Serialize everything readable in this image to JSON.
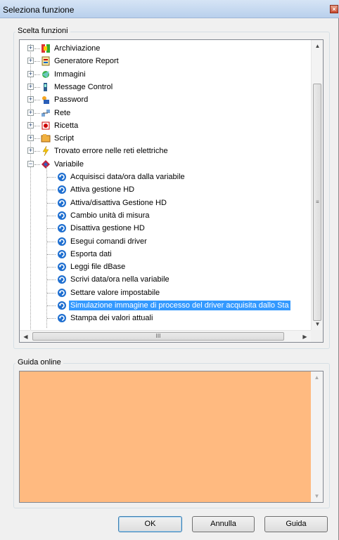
{
  "window": {
    "title": "Seleziona funzione",
    "close_glyph": "×"
  },
  "group_functions": {
    "label": "Scelta funzioni"
  },
  "group_help": {
    "label": "Guida online"
  },
  "tree": {
    "items": [
      {
        "label": "Archiviazione",
        "icon": "archive-icon"
      },
      {
        "label": "Generatore Report",
        "icon": "report-icon"
      },
      {
        "label": "Immagini",
        "icon": "images-icon"
      },
      {
        "label": "Message Control",
        "icon": "message-icon"
      },
      {
        "label": "Password",
        "icon": "password-icon"
      },
      {
        "label": "Rete",
        "icon": "network-icon"
      },
      {
        "label": "Ricetta",
        "icon": "recipe-icon"
      },
      {
        "label": "Script",
        "icon": "script-icon"
      },
      {
        "label": "Trovato errore nelle reti elettriche",
        "icon": "lightning-icon"
      },
      {
        "label": "Variabile",
        "icon": "variable-icon"
      }
    ],
    "children": [
      "Acquisisci data/ora dalla variabile",
      "Attiva gestione HD",
      "Attiva/disattiva Gestione HD",
      "Cambio unità di misura",
      "Disattiva gestione HD",
      "Esegui comandi driver",
      "Esporta dati",
      "Leggi file dBase",
      "Scrivi data/ora nella variabile",
      "Settare valore impostabile",
      "Simulazione immagine di processo del driver acquisita dallo Sta",
      "Stampa dei valori attuali"
    ],
    "selected_child": "Simulazione immagine di processo del driver acquisita dallo Sta"
  },
  "scroll": {
    "up": "▲",
    "down": "▼",
    "left": "◀",
    "right": "▶",
    "grip": "≡",
    "hgrip": "III"
  },
  "buttons": {
    "ok": "OK",
    "cancel": "Annulla",
    "help": "Guida"
  },
  "colors": {
    "selection": "#3399ff",
    "help_bg": "#ffba80"
  }
}
